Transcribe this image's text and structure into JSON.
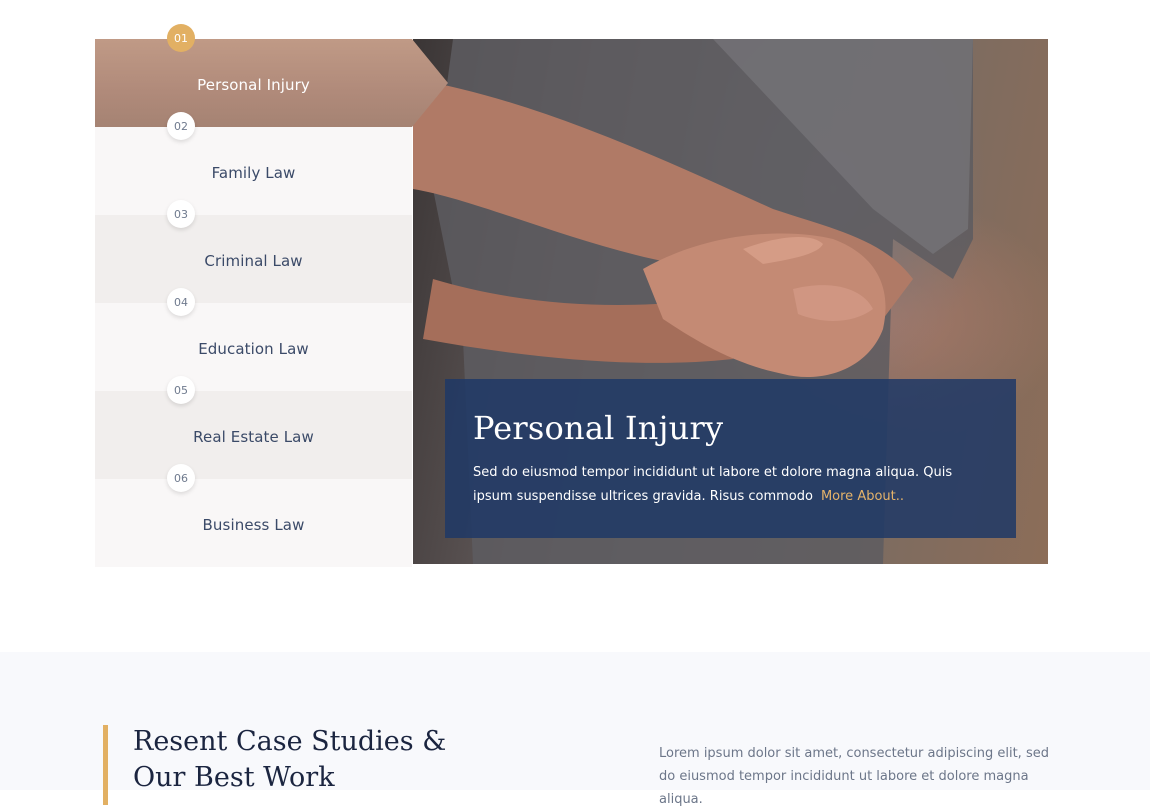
{
  "practice_tabs": [
    {
      "number": "01",
      "label": "Personal Injury"
    },
    {
      "number": "02",
      "label": "Family Law"
    },
    {
      "number": "03",
      "label": "Criminal Law"
    },
    {
      "number": "04",
      "label": "Education Law"
    },
    {
      "number": "05",
      "label": "Real Estate Law"
    },
    {
      "number": "06",
      "label": "Business Law"
    }
  ],
  "active_tab": 0,
  "feature": {
    "title": "Personal Injury",
    "description": "Sed do eiusmod tempor incididunt ut labore et dolore magna aliqua. Quis ipsum suspendisse ultrices gravida. Risus commodo",
    "more_link": "More About.."
  },
  "case_studies": {
    "heading": "Resent Case Studies & Our Best Work",
    "intro": "Lorem ipsum dolor sit amet, consectetur adipiscing elit, sed do eiusmod tempor incididunt ut labore et dolore magna aliqua."
  },
  "colors": {
    "accent_gold": "#e2b063",
    "active_tab": "#b08a7a",
    "card_navy": "#1e3866",
    "heading_dark": "#1b2540"
  }
}
